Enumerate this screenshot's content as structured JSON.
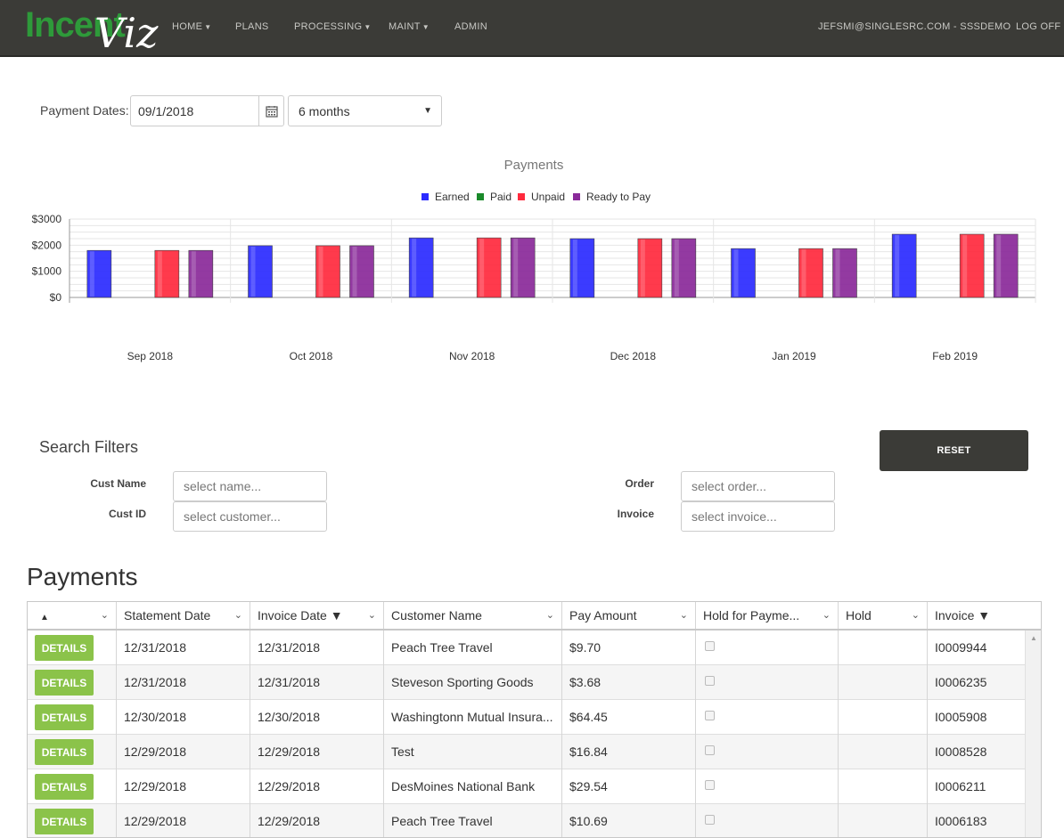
{
  "nav": {
    "logo_part1": "Incent",
    "logo_part2": "Viz",
    "items": [
      "HOME",
      "PLANS",
      "PROCESSING",
      "MAINT",
      "ADMIN"
    ],
    "user": "JEFSMI@SINGLESRC.COM - SSSDEMO",
    "logoff": "LOG OFF"
  },
  "payment_dates": {
    "label": "Payment Dates:",
    "date": "09/1/2018",
    "period": "6 months"
  },
  "chart_data": {
    "type": "bar",
    "title": "Payments",
    "categories": [
      "Sep 2018",
      "Oct 2018",
      "Nov 2018",
      "Dec 2018",
      "Jan 2019",
      "Feb 2019"
    ],
    "series": [
      {
        "name": "Earned",
        "color": "#2b2bff",
        "values": [
          1800,
          1980,
          2280,
          2250,
          1870,
          2420
        ]
      },
      {
        "name": "Paid",
        "color": "#1a8a2a",
        "values": [
          0,
          0,
          0,
          0,
          0,
          0
        ]
      },
      {
        "name": "Unpaid",
        "color": "#ff2a3d",
        "values": [
          1800,
          1980,
          2280,
          2250,
          1870,
          2420
        ]
      },
      {
        "name": "Ready to Pay",
        "color": "#8a2a9a",
        "values": [
          1800,
          1980,
          2280,
          2250,
          1870,
          2420
        ]
      }
    ],
    "y_ticks": [
      "$0",
      "$1000",
      "$2000",
      "$3000"
    ],
    "ylim": [
      0,
      3000
    ],
    "legend": "top-center",
    "grid": true
  },
  "filters": {
    "title": "Search Filters",
    "reset": "RESET",
    "cust_name_label": "Cust Name",
    "cust_name_ph": "select name...",
    "cust_id_label": "Cust ID",
    "cust_id_ph": "select customer...",
    "order_label": "Order",
    "order_ph": "select order...",
    "invoice_label": "Invoice",
    "invoice_ph": "select invoice..."
  },
  "payments": {
    "title": "Payments",
    "headers": [
      "▲",
      "Statement Date",
      "Invoice Date ▼",
      "Customer Name",
      "Pay Amount",
      "Hold for Payme...",
      "Hold",
      "Invoice ▼"
    ],
    "details_label": "DETAILS",
    "rows": [
      [
        "12/31/2018",
        "12/31/2018",
        "Peach Tree Travel",
        "$9.70",
        "I0009944"
      ],
      [
        "12/31/2018",
        "12/31/2018",
        "Steveson Sporting Goods",
        "$3.68",
        "I0006235"
      ],
      [
        "12/30/2018",
        "12/30/2018",
        "Washingtonn Mutual Insura...",
        "$64.45",
        "I0005908"
      ],
      [
        "12/29/2018",
        "12/29/2018",
        "Test",
        "$16.84",
        "I0008528"
      ],
      [
        "12/29/2018",
        "12/29/2018",
        "DesMoines National Bank",
        "$29.54",
        "I0006211"
      ],
      [
        "12/29/2018",
        "12/29/2018",
        "Peach Tree Travel",
        "$10.69",
        "I0006183"
      ]
    ]
  }
}
